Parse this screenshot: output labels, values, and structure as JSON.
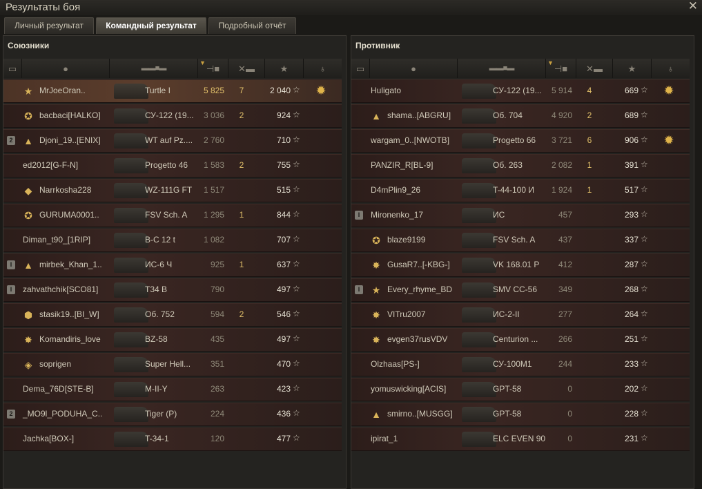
{
  "window": {
    "title": "Результаты боя"
  },
  "tabs": [
    "Личный результат",
    "Командный результат",
    "Подробный отчёт"
  ],
  "allies": {
    "title": "Союзники",
    "rows": [
      {
        "name": "MrJoeOran..",
        "vehicle": "Turtle I",
        "damage": "5 825",
        "frags": "7",
        "xp": "2 040",
        "medal": true,
        "badge": "",
        "emblem": "★",
        "hl": true,
        "dmgHi": true
      },
      {
        "name": "bacbaci[HALKO]",
        "vehicle": "СУ-122 (19...",
        "damage": "3 036",
        "frags": "2",
        "xp": "924",
        "medal": false,
        "badge": "",
        "emblem": "✪",
        "hl": false,
        "dmgHi": false
      },
      {
        "name": "Djoni_19..[ENIX]",
        "vehicle": "WT auf Pz....",
        "damage": "2 760",
        "frags": "",
        "xp": "710",
        "medal": false,
        "badge": "2",
        "emblem": "▲",
        "hl": false,
        "dmgHi": false
      },
      {
        "name": "ed2012[G-F-N]",
        "vehicle": "Progetto 46",
        "damage": "1 583",
        "frags": "2",
        "xp": "755",
        "medal": false,
        "badge": "",
        "emblem": "",
        "hl": false,
        "dmgHi": false
      },
      {
        "name": "Narrkosha228",
        "vehicle": "WZ-111G FT",
        "damage": "1 517",
        "frags": "",
        "xp": "515",
        "medal": false,
        "badge": "",
        "emblem": "◆",
        "hl": false,
        "dmgHi": false
      },
      {
        "name": "GURUMA0001..",
        "vehicle": "FSV Sch. A",
        "damage": "1 295",
        "frags": "1",
        "xp": "844",
        "medal": false,
        "badge": "",
        "emblem": "✪",
        "hl": false,
        "dmgHi": false
      },
      {
        "name": "Diman_t90_[1RIP]",
        "vehicle": "В-С 12 t",
        "damage": "1 082",
        "frags": "",
        "xp": "707",
        "medal": false,
        "badge": "",
        "emblem": "",
        "hl": false,
        "dmgHi": false
      },
      {
        "name": "mirbek_Khan_1..",
        "vehicle": "ИС-6 Ч",
        "damage": "925",
        "frags": "1",
        "xp": "637",
        "medal": false,
        "badge": "I",
        "emblem": "▲",
        "hl": false,
        "dmgHi": false
      },
      {
        "name": "zahvathchik[SCO81]",
        "vehicle": "T34 B",
        "damage": "790",
        "frags": "",
        "xp": "497",
        "medal": false,
        "badge": "I",
        "emblem": "",
        "hl": false,
        "dmgHi": false
      },
      {
        "name": "stasik19..[BI_W]",
        "vehicle": "Об. 752",
        "damage": "594",
        "frags": "2",
        "xp": "546",
        "medal": false,
        "badge": "",
        "emblem": "⬢",
        "hl": false,
        "dmgHi": false
      },
      {
        "name": "Komandiris_love",
        "vehicle": "BZ-58",
        "damage": "435",
        "frags": "",
        "xp": "497",
        "medal": false,
        "badge": "",
        "emblem": "✸",
        "hl": false,
        "dmgHi": false
      },
      {
        "name": "soprigen",
        "vehicle": "Super Hell...",
        "damage": "351",
        "frags": "",
        "xp": "470",
        "medal": false,
        "badge": "",
        "emblem": "◈",
        "hl": false,
        "dmgHi": false
      },
      {
        "name": "Dema_76D[STE-B]",
        "vehicle": "M-II-Y",
        "damage": "263",
        "frags": "",
        "xp": "423",
        "medal": false,
        "badge": "",
        "emblem": "",
        "hl": false,
        "dmgHi": false
      },
      {
        "name": "_MO9l_PODUHA_C..",
        "vehicle": "Tiger (P)",
        "damage": "224",
        "frags": "",
        "xp": "436",
        "medal": false,
        "badge": "2",
        "emblem": "",
        "hl": false,
        "dmgHi": false
      },
      {
        "name": "Jachka[BOX-]",
        "vehicle": "T-34-1",
        "damage": "120",
        "frags": "",
        "xp": "477",
        "medal": false,
        "badge": "",
        "emblem": "",
        "hl": false,
        "dmgHi": false
      }
    ]
  },
  "enemies": {
    "title": "Противник",
    "rows": [
      {
        "name": "Huligato",
        "vehicle": "СУ-122 (19...",
        "damage": "5 914",
        "frags": "4",
        "xp": "669",
        "medal": true,
        "badge": "",
        "emblem": "",
        "hl": false,
        "dmgHi": false
      },
      {
        "name": "shama..[ABGRU]",
        "vehicle": "Об. 704",
        "damage": "4 920",
        "frags": "2",
        "xp": "689",
        "medal": false,
        "badge": "",
        "emblem": "▲",
        "hl": false,
        "dmgHi": false
      },
      {
        "name": "wargam_0..[NWOTB]",
        "vehicle": "Progetto 66",
        "damage": "3 721",
        "frags": "6",
        "xp": "906",
        "medal": true,
        "badge": "",
        "emblem": "",
        "hl": false,
        "dmgHi": false
      },
      {
        "name": "PANZIR_R[BL-9]",
        "vehicle": "Об. 263",
        "damage": "2 082",
        "frags": "1",
        "xp": "391",
        "medal": false,
        "badge": "",
        "emblem": "",
        "hl": false,
        "dmgHi": false
      },
      {
        "name": "D4mPlin9_26",
        "vehicle": "T-44-100 И",
        "damage": "1 924",
        "frags": "1",
        "xp": "517",
        "medal": false,
        "badge": "",
        "emblem": "",
        "hl": false,
        "dmgHi": false
      },
      {
        "name": "Mironenko_17",
        "vehicle": "ИС",
        "damage": "457",
        "frags": "",
        "xp": "293",
        "medal": false,
        "badge": "I",
        "emblem": "",
        "hl": false,
        "dmgHi": false
      },
      {
        "name": "blaze9199",
        "vehicle": "FSV Sch. A",
        "damage": "437",
        "frags": "",
        "xp": "337",
        "medal": false,
        "badge": "",
        "emblem": "✪",
        "hl": false,
        "dmgHi": false
      },
      {
        "name": "GusaR7..[-KBG-]",
        "vehicle": "VK 168.01 P",
        "damage": "412",
        "frags": "",
        "xp": "287",
        "medal": false,
        "badge": "",
        "emblem": "✸",
        "hl": false,
        "dmgHi": false
      },
      {
        "name": "Every_rhyme_BD",
        "vehicle": "SMV CC-56",
        "damage": "349",
        "frags": "",
        "xp": "268",
        "medal": false,
        "badge": "I",
        "emblem": "★",
        "hl": false,
        "dmgHi": false
      },
      {
        "name": "VITru2007",
        "vehicle": "ИС-2-II",
        "damage": "277",
        "frags": "",
        "xp": "264",
        "medal": false,
        "badge": "",
        "emblem": "✸",
        "hl": false,
        "dmgHi": false
      },
      {
        "name": "evgen37rusVDV",
        "vehicle": "Centurion ...",
        "damage": "266",
        "frags": "",
        "xp": "251",
        "medal": false,
        "badge": "",
        "emblem": "✸",
        "hl": false,
        "dmgHi": false
      },
      {
        "name": "Olzhaas[PS-]",
        "vehicle": "СУ-100М1",
        "damage": "244",
        "frags": "",
        "xp": "233",
        "medal": false,
        "badge": "",
        "emblem": "",
        "hl": false,
        "dmgHi": false
      },
      {
        "name": "yomuswicking[ACIS]",
        "vehicle": "GPT-58",
        "damage": "0",
        "frags": "",
        "xp": "202",
        "medal": false,
        "badge": "",
        "emblem": "",
        "hl": false,
        "dmgHi": false
      },
      {
        "name": "smirno..[MUSGG]",
        "vehicle": "GPT-58",
        "damage": "0",
        "frags": "",
        "xp": "228",
        "medal": false,
        "badge": "",
        "emblem": "▲",
        "hl": false,
        "dmgHi": false
      },
      {
        "name": "ipirat_1",
        "vehicle": "ELC EVEN 90",
        "damage": "0",
        "frags": "",
        "xp": "231",
        "medal": false,
        "badge": "",
        "emblem": "",
        "hl": false,
        "dmgHi": false
      }
    ]
  }
}
